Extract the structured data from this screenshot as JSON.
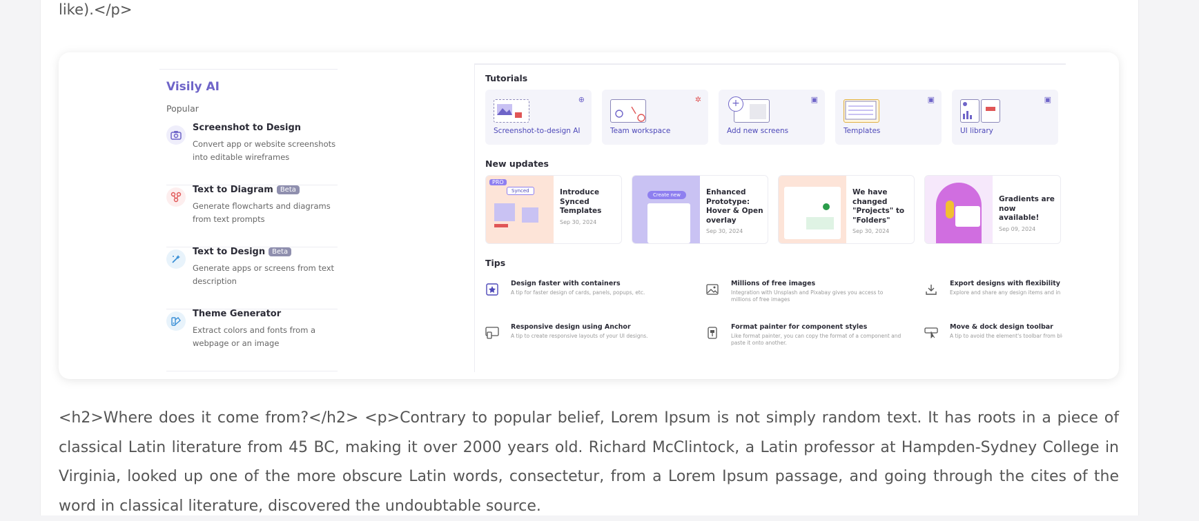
{
  "article": {
    "top_text": "like).</p>",
    "body_text": "<h2>Where does it come from?</h2> <p>Contrary to popular belief, Lorem Ipsum is not simply random text. It has roots in a piece of classical Latin literature from 45 BC, making it over 2000 years old. Richard McClintock, a Latin professor at Hampden-Sydney College in Virginia, looked up one of the more obscure Latin words, consectetur, from a Lorem Ipsum passage, and going through the cites of the word in classical literature, discovered the undoubtable source."
  },
  "left_panel": {
    "title": "Visily AI",
    "section_label": "Popular",
    "features": [
      {
        "title": "Screenshot to Design",
        "desc": "Convert app or website screenshots into editable wireframes",
        "icon": "camera-icon",
        "beta": ""
      },
      {
        "title": "Text to Diagram",
        "desc": "Generate flowcharts and diagrams from text prompts",
        "icon": "diagram-icon",
        "beta": "Beta"
      },
      {
        "title": "Text to Design",
        "desc": "Generate apps or screens from text description",
        "icon": "magic-wand-icon",
        "beta": "Beta"
      },
      {
        "title": "Theme Generator",
        "desc": "Extract colors and fonts from a webpage or an image",
        "icon": "palette-icon",
        "beta": ""
      }
    ]
  },
  "right_panel": {
    "tutorials_title": "Tutorials",
    "tutorials": [
      {
        "label": "Screenshot-to-design AI"
      },
      {
        "label": "Team workspace"
      },
      {
        "label": "Add new screens"
      },
      {
        "label": "Templates"
      },
      {
        "label": "UI library"
      }
    ],
    "updates_title": "New updates",
    "updates": [
      {
        "title": "Introduce Synced Templates",
        "date": "Sep 30, 2024",
        "badge": "PRO",
        "thumb_label": "Synced"
      },
      {
        "title": "Enhanced Prototype: Hover & Open overlay",
        "date": "Sep 30, 2024",
        "badge": "",
        "thumb_label": "Create new"
      },
      {
        "title": "We have changed \"Projects\" to \"Folders\"",
        "date": "Sep 30, 2024",
        "badge": "",
        "thumb_label": ""
      },
      {
        "title": "Gradients are now available!",
        "date": "Sep 09, 2024",
        "badge": "",
        "thumb_label": ""
      }
    ],
    "tips_title": "Tips",
    "tips": [
      {
        "title": "Design faster with containers",
        "desc": "A tip for faster design of cards, panels, popups, etc.",
        "icon": "container-star-icon"
      },
      {
        "title": "Millions of free images",
        "desc": "Integration with Unsplash and Pixabay gives you access to millions of free images",
        "icon": "image-icon"
      },
      {
        "title": "Export designs with flexibility",
        "desc": "Explore and share any design items and in any fo",
        "icon": "download-icon"
      },
      {
        "title": "Responsive design using Anchor",
        "desc": "A tip to create responsive layouts of your UI designs.",
        "icon": "anchor-layout-icon"
      },
      {
        "title": "Format painter for component styles",
        "desc": "Like format painter, you can copy the format of a component and paste it onto another.",
        "icon": "format-painter-icon"
      },
      {
        "title": "Move & dock design toolbar",
        "desc": "A tip to avoid the element's toolbar from blockin",
        "icon": "toolbar-cursor-icon"
      }
    ]
  },
  "colors": {
    "accent": "#6e64c8",
    "link": "#4d48b8",
    "beta_badge": "#8f8fae",
    "page_bg": "#f4f4f6"
  }
}
